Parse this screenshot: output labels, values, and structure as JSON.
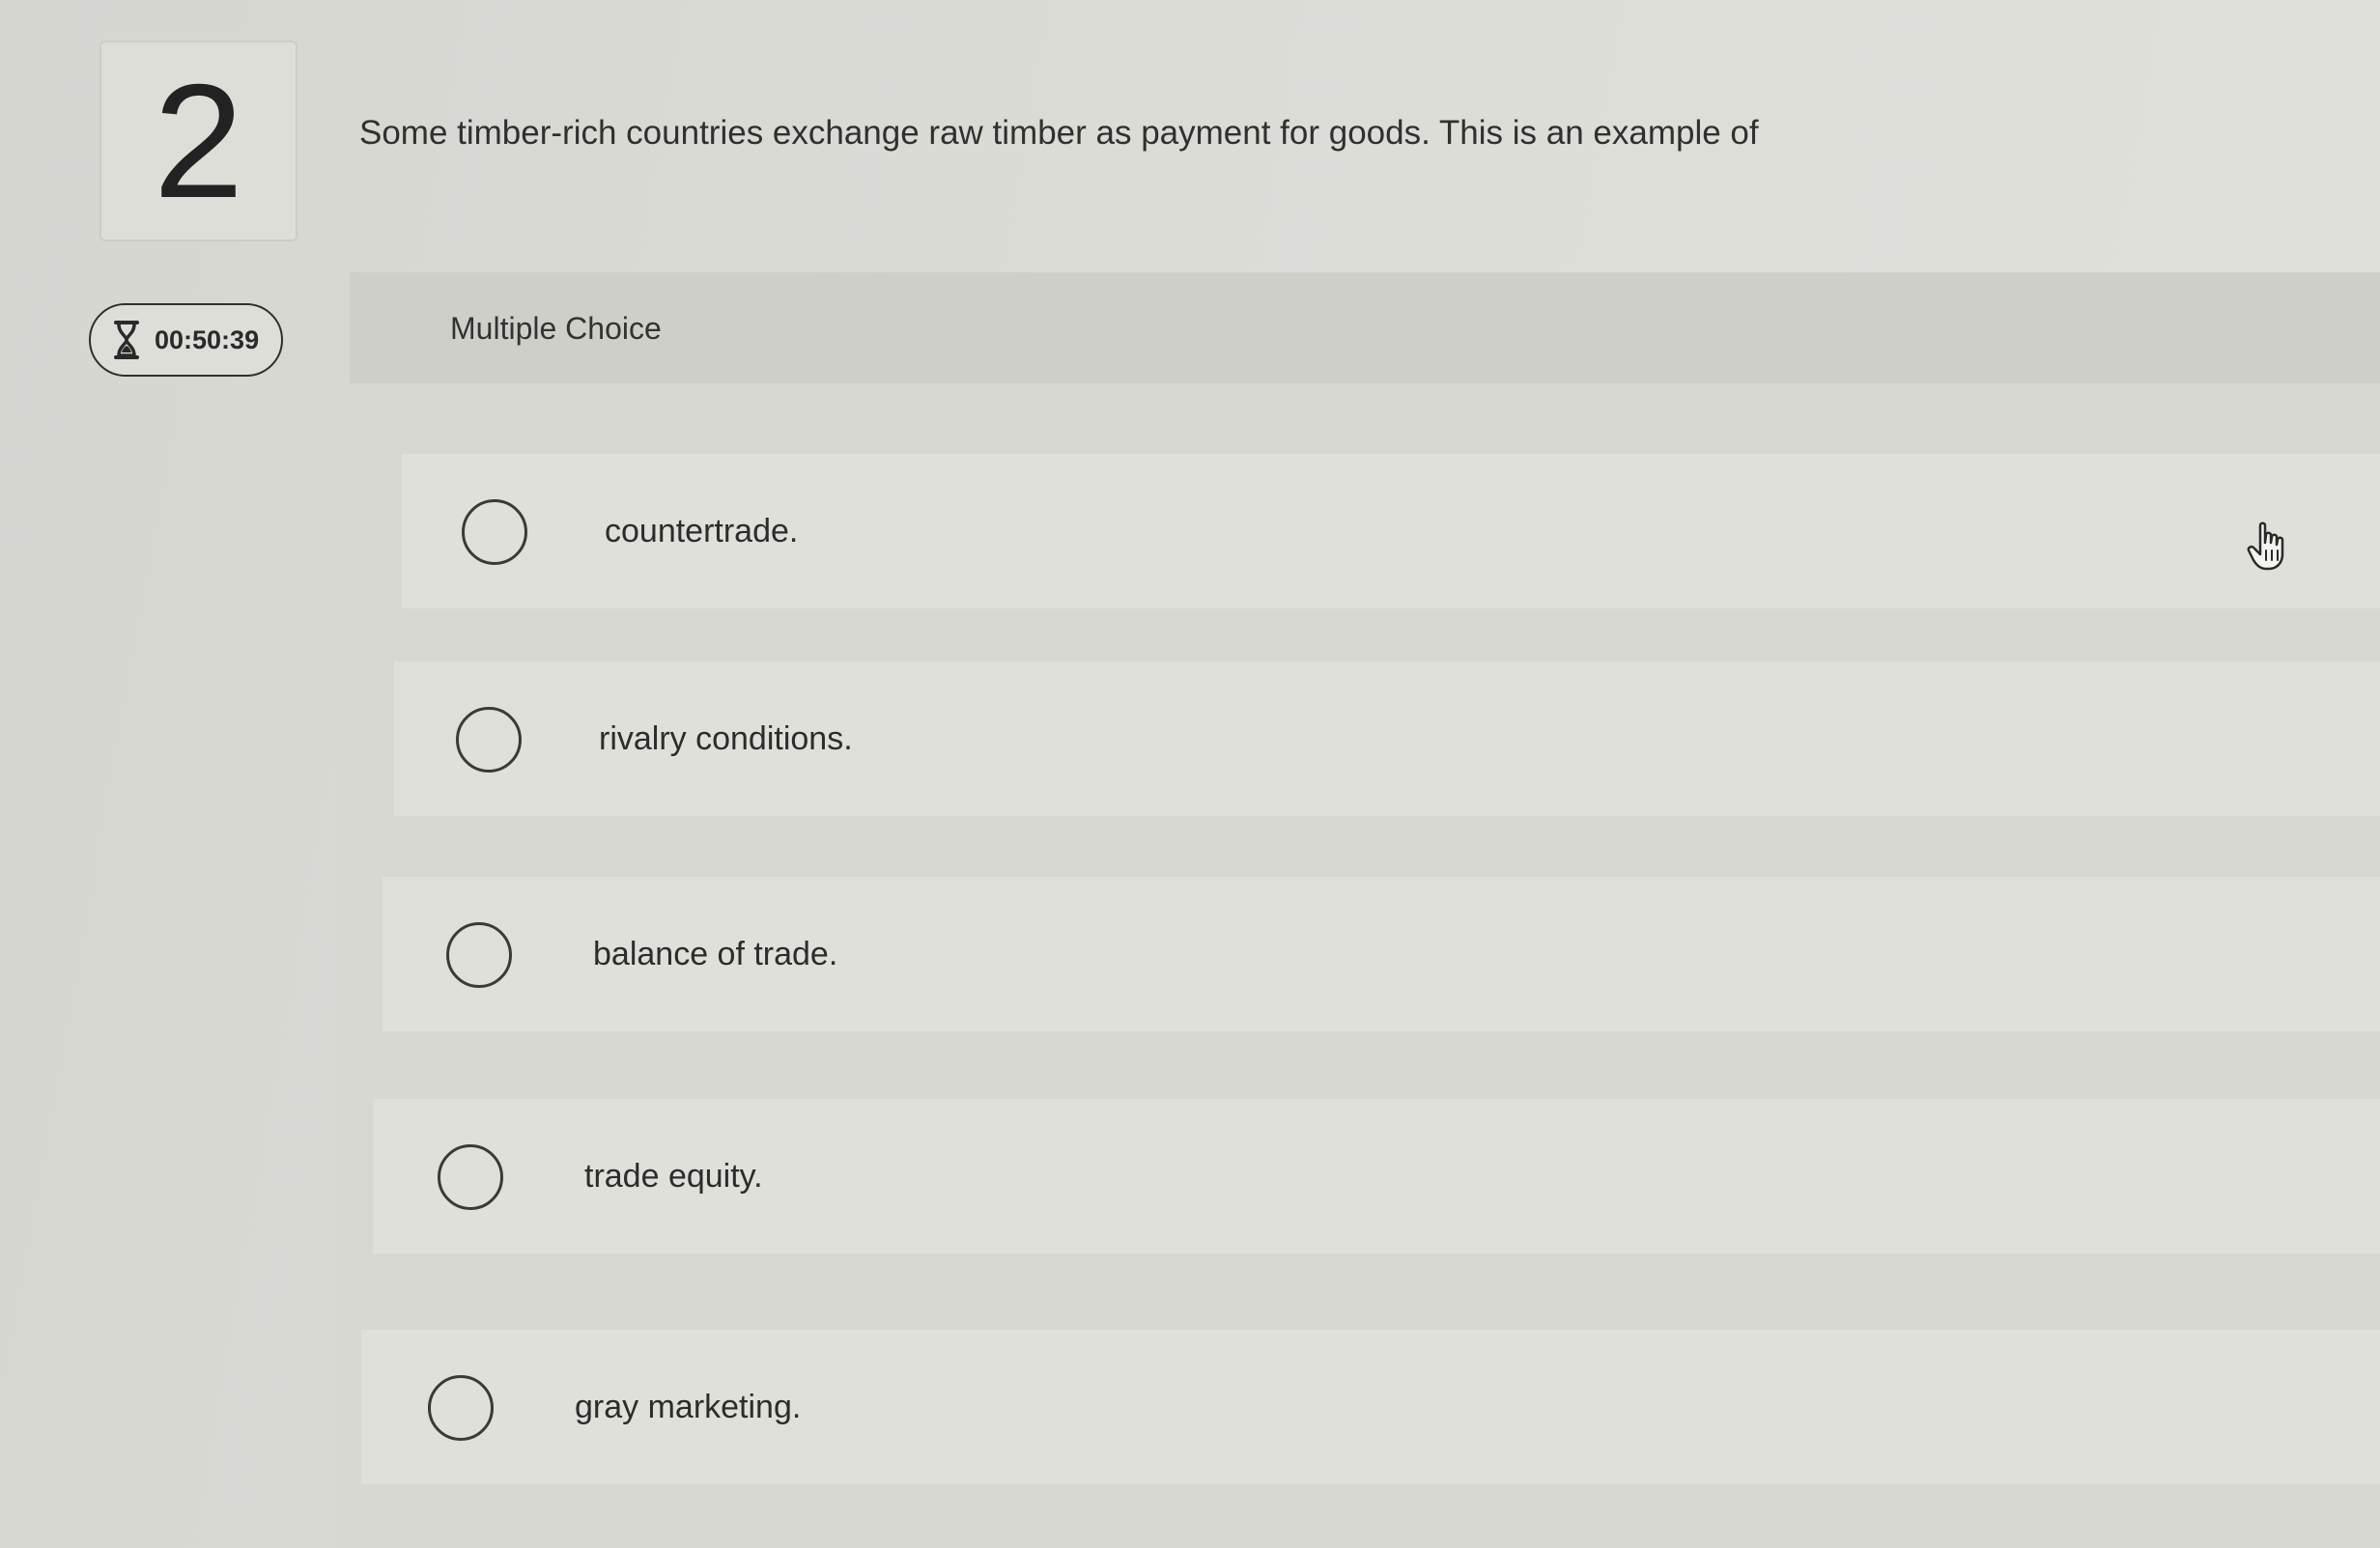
{
  "question": {
    "number": "2",
    "text": "Some timber-rich countries exchange raw timber as payment for goods. This is an example of"
  },
  "timer": {
    "icon": "hourglass-icon",
    "value": "00:50:39"
  },
  "choices": {
    "type_label": "Multiple Choice",
    "options": [
      {
        "label": "countertrade.",
        "selected": false
      },
      {
        "label": "rivalry conditions.",
        "selected": false
      },
      {
        "label": "balance of trade.",
        "selected": false
      },
      {
        "label": "trade equity.",
        "selected": false
      },
      {
        "label": "gray marketing.",
        "selected": false
      }
    ]
  },
  "cursor": {
    "icon": "hand-pointer-icon"
  }
}
